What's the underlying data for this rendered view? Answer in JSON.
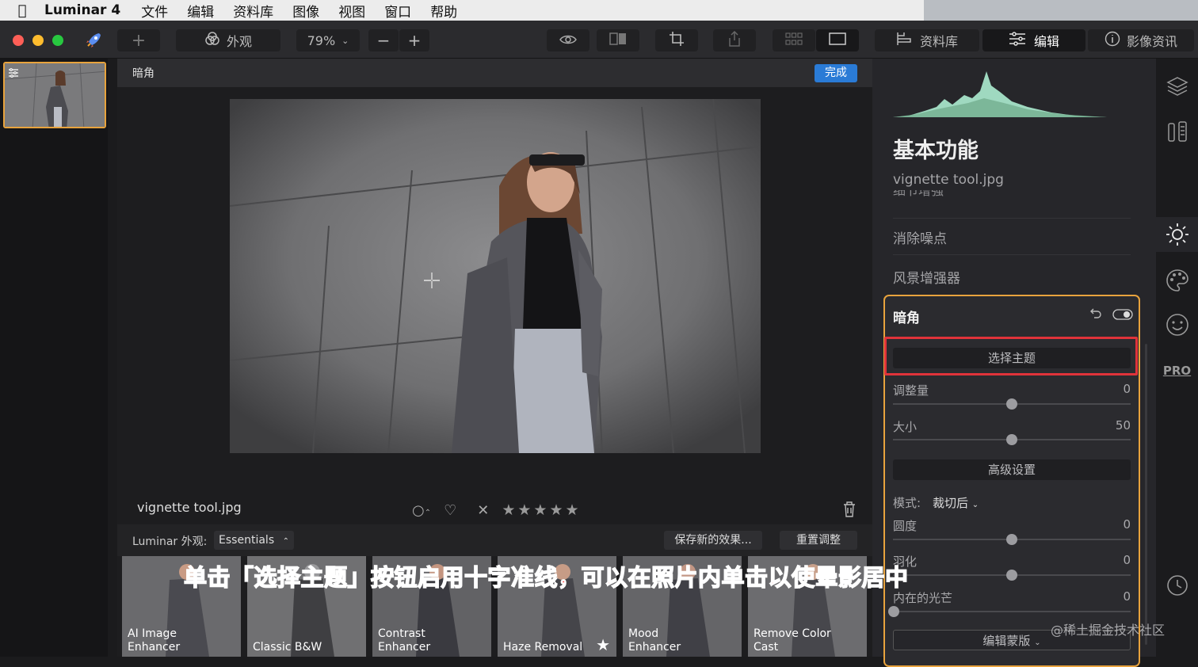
{
  "menubar": {
    "app_name": "Luminar 4",
    "items": [
      "文件",
      "编辑",
      "资料库",
      "图像",
      "视图",
      "窗口",
      "帮助"
    ]
  },
  "toolbar": {
    "looks_label": "外观",
    "zoom": "79%",
    "tabs": [
      {
        "label": "资料库",
        "icon": "library-icon"
      },
      {
        "label": "编辑",
        "icon": "sliders-icon",
        "active": true
      },
      {
        "label": "影像资讯",
        "icon": "info-icon"
      }
    ]
  },
  "edit_bar": {
    "tool_title": "暗角",
    "done_label": "完成"
  },
  "photo_info": {
    "filename": "vignette tool.jpg"
  },
  "looks": {
    "label": "Luminar 外观:",
    "collection": "Essentials",
    "save_label": "保存新的效果...",
    "reset_label": "重置调整",
    "presets": [
      {
        "line1": "AI Image",
        "line2": "Enhancer"
      },
      {
        "line1": "",
        "line2": "Classic B&W"
      },
      {
        "line1": "Contrast",
        "line2": "Enhancer"
      },
      {
        "line1": "",
        "line2": "Haze Removal"
      },
      {
        "line1": "Mood",
        "line2": "Enhancer"
      },
      {
        "line1": "Remove Color",
        "line2": "Cast"
      }
    ]
  },
  "caption": "单击「选择主题」按钮启用十字准线，可以在照片内单击以使晕影居中",
  "right_panel": {
    "title": "基本功能",
    "filename": "vignette tool.jpg",
    "partial_item": "细节增强",
    "items": [
      "消除噪点",
      "风景增强器"
    ],
    "vignette": {
      "title": "暗角",
      "select_subject": "选择主题",
      "amount_label": "调整量",
      "amount_value": "0",
      "size_label": "大小",
      "size_value": "50",
      "advanced_label": "高级设置",
      "mode_label": "模式:",
      "mode_value": "裁切后",
      "roundness_label": "圆度",
      "roundness_value": "0",
      "feather_label": "羽化",
      "feather_value": "0",
      "inner_light_label": "内在的光芒",
      "inner_light_value": "0",
      "mask_label": "编辑蒙版"
    }
  },
  "sidebar": {
    "pro_label": "PRO"
  },
  "watermark": "@稀土掘金技术社区"
}
